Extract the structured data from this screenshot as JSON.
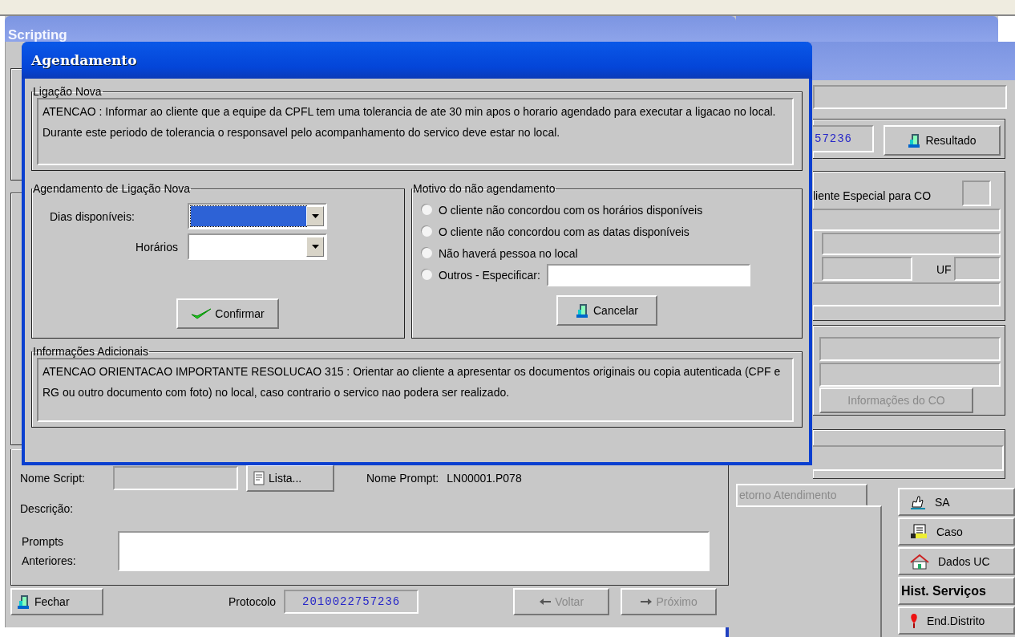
{
  "scripting": {
    "title": "Scripting",
    "nome_script_label": "Nome Script:",
    "lista_button": "Lista...",
    "nome_prompt_label": "Nome Prompt:",
    "nome_prompt_value": "LN00001.P078",
    "descricao_label": "Descrição:",
    "prompts_label": "Prompts Anteriores:",
    "fechar_button": "Fechar",
    "protocolo_label": "Protocolo",
    "protocolo_value": "2010022757236",
    "nav_buttons": [
      {
        "label": "Voltar",
        "kind": "back",
        "disabled": true
      },
      {
        "label": "Próximo",
        "kind": "next",
        "disabled": true
      }
    ]
  },
  "right_panel": {
    "protocolo_partial": "57236",
    "resultado_button": "Resultado",
    "cliente_especial_label": "liente Especial para CO",
    "uf_label": "UF",
    "info_co_button": {
      "label": "Informações do CO",
      "disabled": true
    },
    "tab": {
      "label": "etorno Atendimento",
      "disabled": true
    },
    "side_buttons": [
      {
        "label": "SA",
        "kind": "hand"
      },
      {
        "label": "Caso",
        "kind": "file"
      },
      {
        "label": "Dados UC",
        "kind": "house"
      },
      {
        "label": "Hist. Serviços",
        "kind": "text"
      },
      {
        "label": "End.Distrito",
        "kind": "pin"
      }
    ]
  },
  "dialog": {
    "title": "Agendamento",
    "ligacao_nova": {
      "legend": "Ligação Nova",
      "text": "ATENCAO : Informar ao cliente que a equipe da CPFL tem uma tolerancia de ate 30 min apos o horario agendado para executar a ligacao no local. Durante este periodo de tolerancia o responsavel pelo acompanhamento do servico deve estar no local."
    },
    "agendamento": {
      "legend": "Agendamento de Ligação Nova",
      "fields": [
        {
          "label": "Dias disponíveis:",
          "focused": true
        },
        {
          "label": "Horários",
          "focused": false
        }
      ],
      "confirm_button": "Confirmar"
    },
    "motivo": {
      "legend": "Motivo do não agendamento",
      "options": [
        {
          "label": "O cliente não concordou com os horários disponíveis",
          "selected": false
        },
        {
          "label": "O cliente não concordou com as datas disponíveis",
          "selected": false
        },
        {
          "label": "Não haverá pessoa no local",
          "selected": false
        },
        {
          "label": "Outros - Especificar:",
          "selected": false,
          "kind": "input"
        }
      ],
      "cancel_button": "Cancelar"
    },
    "info": {
      "legend": "Informações Adicionais",
      "text": "ATENCAO ORIENTACAO IMPORTANTE RESOLUCAO 315 : Orientar ao cliente a apresentar os documentos originais ou copia autenticada (CPF e RG ou outro documento com foto) no local, caso contrario o servico nao podera ser realizado."
    }
  }
}
